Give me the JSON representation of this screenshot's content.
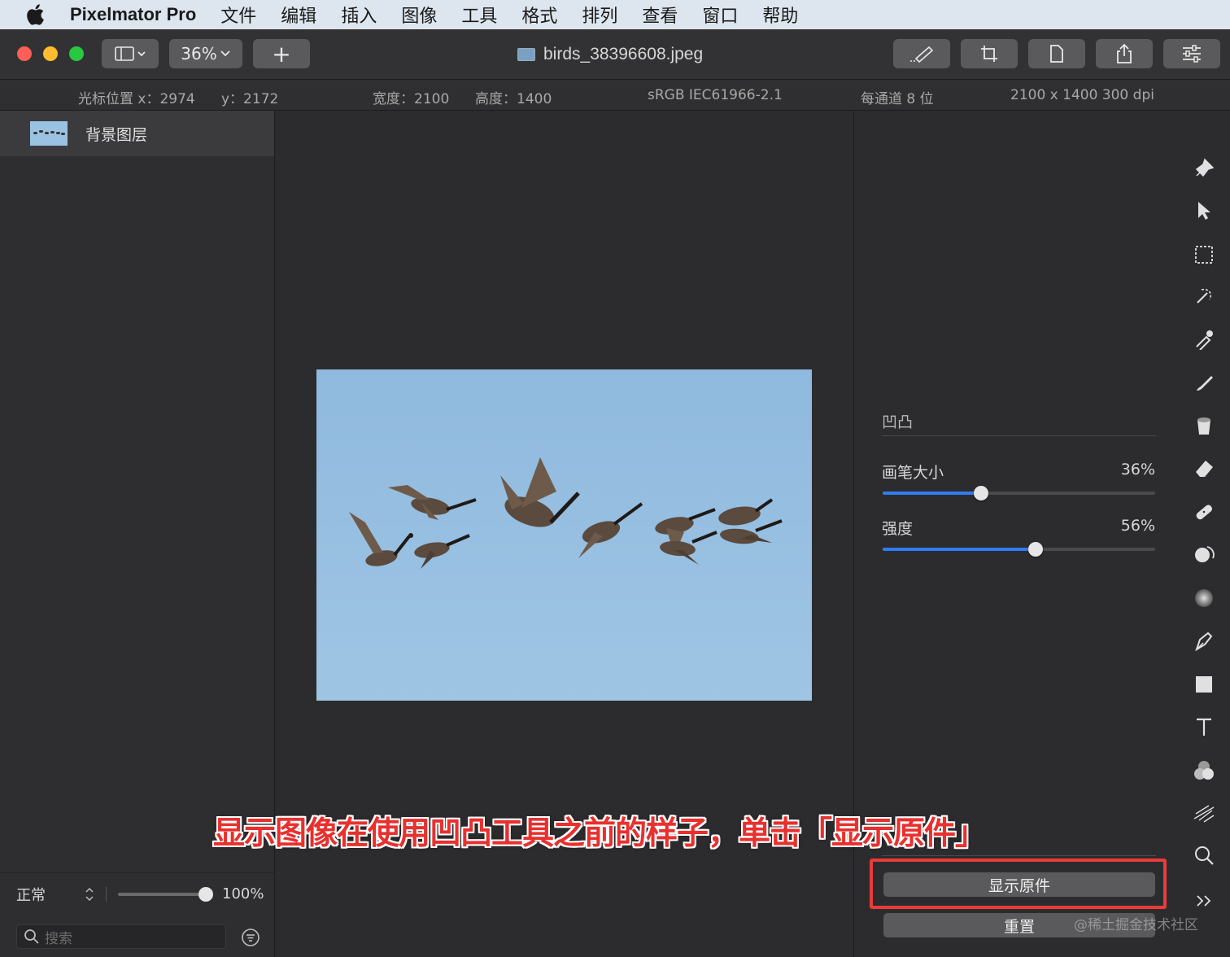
{
  "menubar": {
    "app_name": "Pixelmator Pro",
    "items": [
      "文件",
      "编辑",
      "插入",
      "图像",
      "工具",
      "格式",
      "排列",
      "查看",
      "窗口",
      "帮助"
    ]
  },
  "toolbar": {
    "zoom": "36%",
    "add_label": "+",
    "document_title": "birds_38396608.jpeg"
  },
  "infobar": {
    "cursor_x": "光标位置 x：2974",
    "cursor_y": "y：2172",
    "width": "宽度：2100",
    "height": "高度：1400",
    "color_profile": "sRGB IEC61966-2.1",
    "bit_depth": "每通道 8 位",
    "dimensions": "2100 x 1400 300 dpi"
  },
  "layers": {
    "items": [
      {
        "name": "背景图层"
      }
    ],
    "blend_mode": "正常",
    "opacity_label": "100%",
    "opacity_value": 1.0,
    "search_placeholder": "搜索"
  },
  "tool_options": {
    "section_title": "凹凸",
    "brush_size": {
      "label": "画笔大小",
      "value_label": "36%",
      "value": 0.36
    },
    "strength": {
      "label": "强度",
      "value_label": "56%",
      "value": 0.56
    },
    "show_original_label": "显示原件",
    "reset_label": "重置"
  },
  "annotation": {
    "text": "显示图像在使用凹凸工具之前的样子，单击「显示原件」"
  },
  "watermark": "@稀土掘金技术社区",
  "colors": {
    "accent": "#2f7cf6",
    "highlight": "#ea3b3b",
    "sky": "#9cc3e3"
  }
}
